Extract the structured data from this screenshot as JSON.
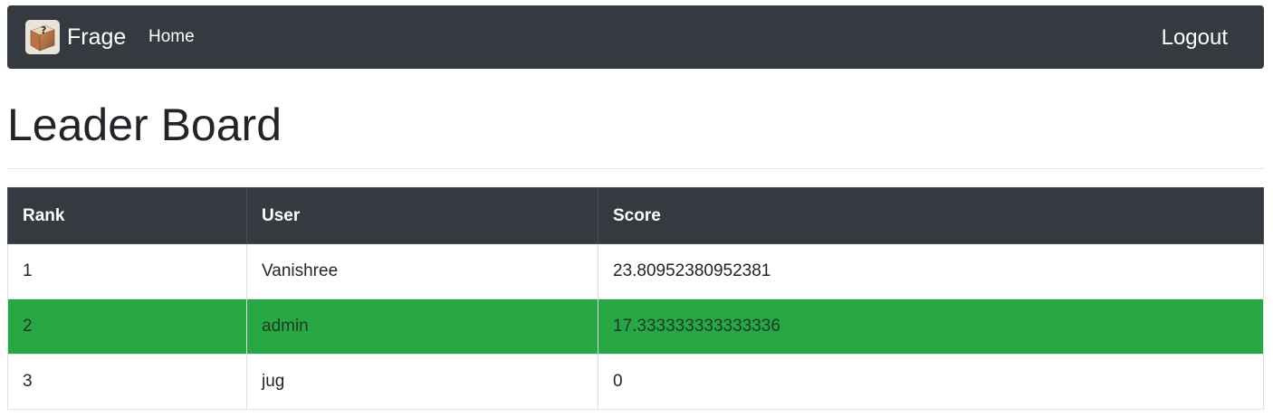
{
  "navbar": {
    "brand_label": "Frage",
    "brand_icon": "question-box-icon",
    "home_label": "Home",
    "logout_label": "Logout",
    "background_color": "#343a40"
  },
  "page": {
    "title": "Leader Board"
  },
  "leaderboard": {
    "columns": [
      "Rank",
      "User",
      "Score"
    ],
    "rows": [
      {
        "rank": "1",
        "user": "Vanishree",
        "score": "23.80952380952381",
        "highlighted": false
      },
      {
        "rank": "2",
        "user": "admin",
        "score": "17.333333333333336",
        "highlighted": true
      },
      {
        "rank": "3",
        "user": "jug",
        "score": "0",
        "highlighted": false
      }
    ],
    "highlight_color": "#28a745",
    "header_color": "#343a40"
  }
}
